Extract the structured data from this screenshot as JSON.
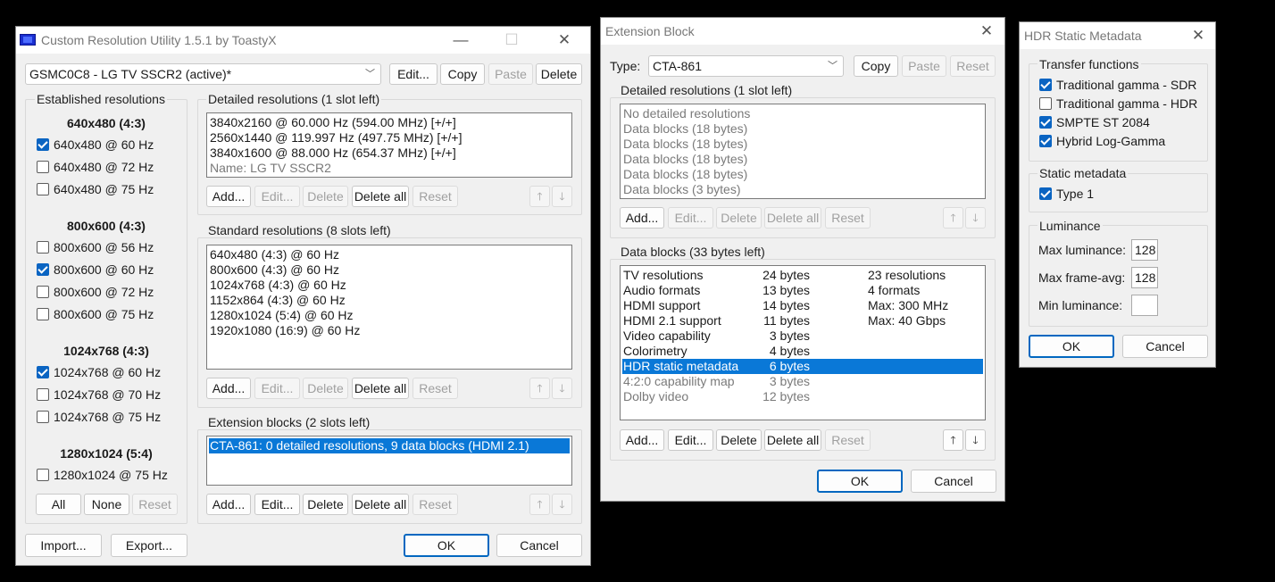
{
  "main": {
    "title": "Custom Resolution Utility 1.5.1 by ToastyX",
    "monitor": "GSMC0C8 - LG TV SSCR2 (active)*",
    "top_buttons": {
      "edit": "Edit...",
      "copy": "Copy",
      "paste": "Paste",
      "delete": "Delete"
    },
    "established": {
      "label": "Established resolutions",
      "groups": [
        {
          "header": "640x480 (4:3)",
          "items": [
            {
              "label": "640x480 @ 60 Hz",
              "checked": true
            },
            {
              "label": "640x480 @ 72 Hz",
              "checked": false
            },
            {
              "label": "640x480 @ 75 Hz",
              "checked": false
            }
          ]
        },
        {
          "header": "800x600 (4:3)",
          "items": [
            {
              "label": "800x600 @ 56 Hz",
              "checked": false
            },
            {
              "label": "800x600 @ 60 Hz",
              "checked": true
            },
            {
              "label": "800x600 @ 72 Hz",
              "checked": false
            },
            {
              "label": "800x600 @ 75 Hz",
              "checked": false
            }
          ]
        },
        {
          "header": "1024x768 (4:3)",
          "items": [
            {
              "label": "1024x768 @ 60 Hz",
              "checked": true
            },
            {
              "label": "1024x768 @ 70 Hz",
              "checked": false
            },
            {
              "label": "1024x768 @ 75 Hz",
              "checked": false
            }
          ]
        },
        {
          "header": "1280x1024 (5:4)",
          "items": [
            {
              "label": "1280x1024 @ 75 Hz",
              "checked": false
            }
          ]
        }
      ],
      "buttons": {
        "all": "All",
        "none": "None",
        "reset": "Reset"
      }
    },
    "detailed": {
      "label": "Detailed resolutions (1 slot left)",
      "items": [
        "3840x2160 @ 60.000 Hz (594.00 MHz) [+/+]",
        "2560x1440 @ 119.997 Hz (497.75 MHz) [+/+]",
        "3840x1600 @ 88.000 Hz (654.37 MHz) [+/+]"
      ],
      "name_line": "Name: LG TV SSCR2"
    },
    "standard": {
      "label": "Standard resolutions (8 slots left)",
      "items": [
        "640x480 (4:3) @ 60 Hz",
        "800x600 (4:3) @ 60 Hz",
        "1024x768 (4:3) @ 60 Hz",
        "1152x864 (4:3) @ 60 Hz",
        "1280x1024 (5:4) @ 60 Hz",
        "1920x1080 (16:9) @ 60 Hz"
      ]
    },
    "extension": {
      "label": "Extension blocks (2 slots left)",
      "items": [
        "CTA-861: 0 detailed resolutions, 9 data blocks (HDMI 2.1)"
      ]
    },
    "list_buttons": {
      "add": "Add...",
      "edit": "Edit...",
      "delete": "Delete",
      "delete_all": "Delete all",
      "reset": "Reset",
      "up": "🡑",
      "down": "🡓"
    },
    "bottom": {
      "import": "Import...",
      "export": "Export...",
      "ok": "OK",
      "cancel": "Cancel"
    }
  },
  "ext": {
    "title": "Extension Block",
    "type_label": "Type:",
    "type_value": "CTA-861",
    "top_buttons": {
      "copy": "Copy",
      "paste": "Paste",
      "reset": "Reset"
    },
    "detailed": {
      "label": "Detailed resolutions (1 slot left)",
      "items": [
        "No detailed resolutions",
        "Data blocks (18 bytes)",
        "Data blocks (18 bytes)",
        "Data blocks (18 bytes)",
        "Data blocks (18 bytes)",
        "Data blocks (3 bytes)"
      ]
    },
    "data_blocks": {
      "label": "Data blocks (33 bytes left)",
      "rows": [
        {
          "name": "TV resolutions",
          "size": "24 bytes",
          "info": "23 resolutions"
        },
        {
          "name": "Audio formats",
          "size": "13 bytes",
          "info": "4 formats"
        },
        {
          "name": "HDMI support",
          "size": "14 bytes",
          "info": "Max: 300 MHz"
        },
        {
          "name": "HDMI 2.1 support",
          "size": "11 bytes",
          "info": "Max: 40 Gbps"
        },
        {
          "name": "Video capability",
          "size": "3 bytes",
          "info": ""
        },
        {
          "name": "Colorimetry",
          "size": "4 bytes",
          "info": ""
        },
        {
          "name": "HDR static metadata",
          "size": "6 bytes",
          "info": ""
        },
        {
          "name": "4:2:0 capability map",
          "size": "3 bytes",
          "info": ""
        },
        {
          "name": "Dolby video",
          "size": "12 bytes",
          "info": ""
        }
      ]
    },
    "list_buttons": {
      "add": "Add...",
      "edit": "Edit...",
      "delete": "Delete",
      "delete_all": "Delete all",
      "reset": "Reset",
      "up": "🡑",
      "down": "🡓"
    },
    "bottom": {
      "ok": "OK",
      "cancel": "Cancel"
    }
  },
  "hdr": {
    "title": "HDR Static Metadata",
    "transfer": {
      "label": "Transfer functions",
      "items": [
        {
          "label": "Traditional gamma - SDR",
          "checked": true
        },
        {
          "label": "Traditional gamma - HDR",
          "checked": false
        },
        {
          "label": "SMPTE ST 2084",
          "checked": true
        },
        {
          "label": "Hybrid Log-Gamma",
          "checked": true
        }
      ]
    },
    "static": {
      "label": "Static metadata",
      "items": [
        {
          "label": "Type 1",
          "checked": true
        }
      ]
    },
    "luminance": {
      "label": "Luminance",
      "max_label": "Max luminance:",
      "max_value": "128",
      "avg_label": "Max frame-avg:",
      "avg_value": "128",
      "min_label": "Min luminance:",
      "min_value": ""
    },
    "bottom": {
      "ok": "OK",
      "cancel": "Cancel"
    }
  },
  "window_controls": {
    "minimize": "—",
    "maximize": "☐",
    "close": "✕"
  },
  "colors": {
    "selection": "#0a78d7",
    "checkbox": "#0a64c2",
    "default_button_border": "#0067c0"
  }
}
